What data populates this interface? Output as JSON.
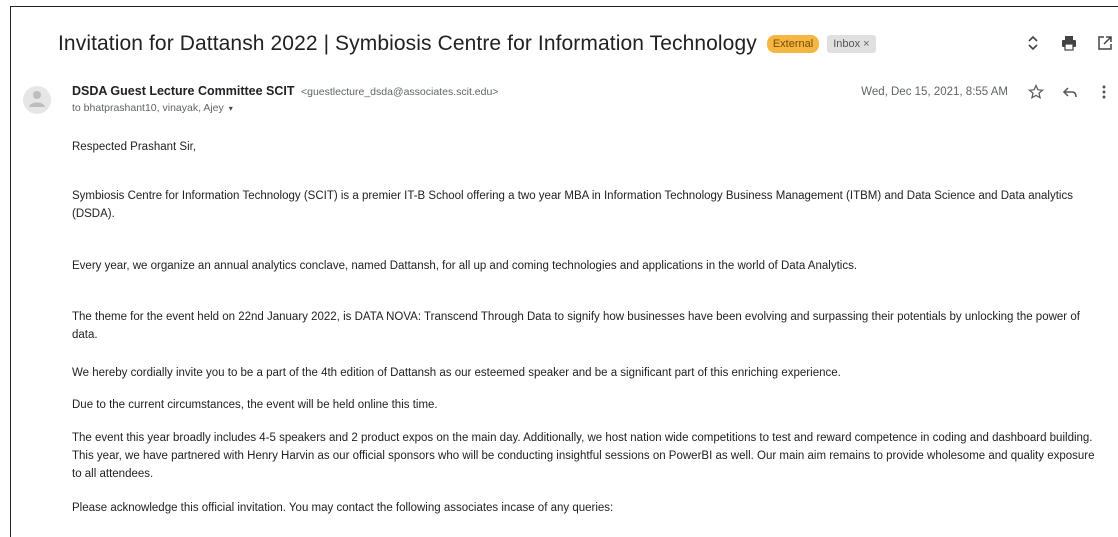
{
  "email": {
    "subject": "Invitation for Dattansh 2022 | Symbiosis Centre for Information Technology",
    "labels": {
      "external": "External",
      "inbox": "Inbox",
      "inbox_remove": "×"
    },
    "sender_name": "DSDA Guest Lecture Committee SCIT",
    "sender_email": "<guestlecture_dsda@associates.scit.edu>",
    "recipients": "to bhatprashant10, vinayak, Ajey",
    "recipients_caret": "▾",
    "date": "Wed, Dec 15, 2021, 8:55 AM",
    "body": {
      "greeting": "Respected Prashant Sir,",
      "p1": "Symbiosis Centre for Information Technology (SCIT) is a premier IT-B School offering a two year MBA in Information Technology Business Management (ITBM) and Data Science and Data analytics (DSDA).",
      "p2": "Every year, we organize an annual analytics conclave, named Dattansh, for all up and coming technologies and applications in the world of Data Analytics.",
      "p3": "The theme for the event held on 22nd January 2022, is DATA NOVA: Transcend Through Data to signify how businesses have been evolving and surpassing their potentials by unlocking the power of data.",
      "p4": "We hereby cordially invite you to be a part of the 4th edition of Dattansh as our esteemed speaker and be a significant part of this enriching experience.",
      "p5": "Due to the current circumstances, the event will be held online this time.",
      "p6": "The event this year broadly includes 4-5 speakers and 2 product expos on the main day. Additionally, we host nation wide competitions to test and reward competence in coding and dashboard building. This year, we have partnered with Henry Harvin as our official sponsors who will be conducting insightful sessions on PowerBI as well. Our main aim remains to provide wholesome and quality exposure to all attendees.",
      "p7": "Please acknowledge this official invitation. You may contact the following associates incase of any queries:"
    }
  },
  "icons": {
    "expand": "expand-collapse-icon",
    "print": "print-icon",
    "open_new_window": "open-in-new-window-icon",
    "avatar": "default-avatar-icon",
    "star": "star-icon",
    "reply": "reply-icon",
    "more": "more-vert-icon"
  },
  "colors": {
    "external_badge": "#f5b642",
    "inbox_badge": "#e0e0e0"
  }
}
